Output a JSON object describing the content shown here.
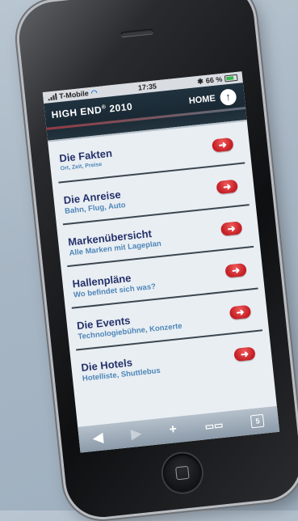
{
  "status": {
    "carrier": "T-Mobile",
    "time": "17:35",
    "battery": "66 %"
  },
  "header": {
    "brand": "HIGH END",
    "brand_mark": "®",
    "brand_year": " 2010",
    "home_label": "HOME"
  },
  "menu": [
    {
      "title": "Die Fakten",
      "subtitle": "Ort, Zeit, Preise"
    },
    {
      "title": "Die Anreise",
      "subtitle": "Bahn, Flug, Auto"
    },
    {
      "title": "Markenübersicht",
      "subtitle": "Alle Marken mit Lageplan"
    },
    {
      "title": "Hallenpläne",
      "subtitle": "Wo befindet sich was?"
    },
    {
      "title": "Die Events",
      "subtitle": "Technologiebühne, Konzerte"
    },
    {
      "title": "Die Hotels",
      "subtitle": "Hotelliste, Shuttlebus"
    }
  ],
  "toolbar": {
    "back": "◀",
    "forward": "▶",
    "add": "+",
    "bookmarks": "📖",
    "pages": "5"
  },
  "colors": {
    "header_bg": "#1a2934",
    "title": "#25316a",
    "subtitle": "#4f86b8",
    "arrow": "#c41e24"
  }
}
